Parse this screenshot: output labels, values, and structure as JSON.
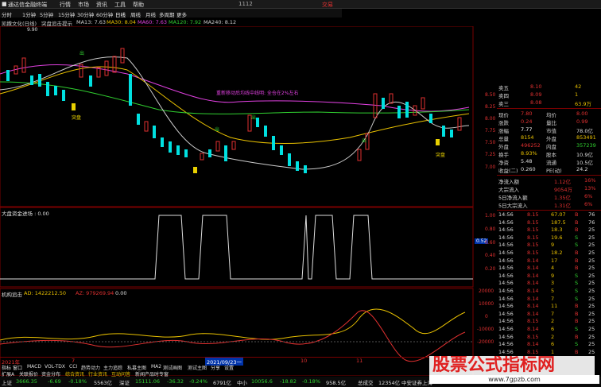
{
  "titlebar": {
    "app": "通达信金融终端",
    "menu": [
      "行情",
      "市场",
      "资讯",
      "工具",
      "帮助"
    ],
    "code": "1112",
    "trade": "交易"
  },
  "toolbar": [
    "分时",
    "1分钟",
    "5分钟",
    "15分钟",
    "30分钟",
    "60分钟",
    "日线",
    "周线",
    "月线",
    "多周期",
    "更多"
  ],
  "ma_legend": [
    {
      "text": "凯撒文化(日线)",
      "color": "#dddddd"
    },
    {
      "text": "突盘追击提示",
      "color": "#dddddd"
    },
    {
      "text": "MA13: 7.63",
      "color": "#dddddd"
    },
    {
      "text": "MA30: 8.04",
      "color": "#e8c000"
    },
    {
      "text": "MA60: 7.63",
      "color": "#e040e0"
    },
    {
      "text": "MA120: 7.92",
      "color": "#30d030"
    },
    {
      "text": "MA240: 8.12",
      "color": "#dddddd"
    }
  ],
  "chart": {
    "high_label": "9.90",
    "annotation": "重新移动后均线中线明: 全仓在2%左右",
    "signals": [
      "突盘",
      "突盘"
    ],
    "markers": [
      "出",
      "出",
      "出",
      "出"
    ]
  },
  "sub1": {
    "title": "大盘资金进场 : 0.00",
    "value_tag": "0.52"
  },
  "sub2": {
    "title": "机构追击",
    "ad": "AD: 1422212.50",
    "az": "AZ: 979269.94",
    "zero": "0.00"
  },
  "axis_main": [
    "8.50",
    "8.25",
    "8.00",
    "7.75",
    "7.50",
    "7.25",
    "7.00"
  ],
  "axis_sub1": [
    "1.00",
    "0.80",
    "0.60",
    "0.40",
    "0.20"
  ],
  "axis_sub2": [
    "20000",
    "10000",
    "0",
    "-10000",
    "-20000"
  ],
  "quote": {
    "book": [
      {
        "label": "卖五",
        "price": "8.10"
      },
      {
        "label": "卖四",
        "price": "8.09"
      },
      {
        "label": "卖三",
        "price": "8.08"
      }
    ],
    "vols": [
      "42",
      "1",
      "63.9万"
    ],
    "stats": [
      {
        "l1": "现价",
        "v1": "7.80",
        "l2": "均价",
        "v2": "8.00"
      },
      {
        "l1": "涨跌",
        "v1": "0.24",
        "l2": "量比",
        "v2": "0.99"
      },
      {
        "l1": "涨幅",
        "v1": "7.77",
        "l2": "市值",
        "v2": "78.0亿"
      },
      {
        "l1": "总量",
        "v1": "8154",
        "l2": "外盘",
        "v2": "853491"
      },
      {
        "l1": "外盘",
        "v1": "496252",
        "l2": "内盘",
        "v2": "357239"
      },
      {
        "l1": "换手",
        "v1": "8.93%",
        "l2": "股本",
        "v2": "10.9亿"
      },
      {
        "l1": "净资",
        "v1": "5.48",
        "l2": "流通",
        "v2": "10.5亿"
      },
      {
        "l1": "收益(二)",
        "v1": "0.260",
        "l2": "PE(动)",
        "v2": "24.2"
      }
    ],
    "flows": [
      {
        "label": "净流入额",
        "value": "1.12亿",
        "pct": "16%"
      },
      {
        "label": "大宗流入",
        "value": "9054万",
        "pct": "13%"
      },
      {
        "label": "5日净流入额",
        "value": "1.35亿",
        "pct": "6%"
      },
      {
        "label": "5日大宗流入",
        "value": "1.31亿",
        "pct": "6%"
      }
    ],
    "ticks": [
      {
        "t": "14:56",
        "p": "8.15",
        "v": "67.07",
        "s": "B",
        "n": "76"
      },
      {
        "t": "14:56",
        "p": "8.15",
        "v": "187.5",
        "s": "B",
        "n": "76"
      },
      {
        "t": "14:56",
        "p": "8.15",
        "v": "18.3",
        "s": "B",
        "n": "25"
      },
      {
        "t": "14:56",
        "p": "8.15",
        "v": "19.6",
        "s": "S",
        "n": "25"
      },
      {
        "t": "14:56",
        "p": "8.15",
        "v": "9",
        "s": "S",
        "n": "25"
      },
      {
        "t": "14:56",
        "p": "8.15",
        "v": "18.2",
        "s": "B",
        "n": "25"
      },
      {
        "t": "14:56",
        "p": "8.14",
        "v": "17",
        "s": "B",
        "n": "25"
      },
      {
        "t": "14:56",
        "p": "8.14",
        "v": "4",
        "s": "B",
        "n": "25"
      },
      {
        "t": "14:56",
        "p": "8.14",
        "v": "9",
        "s": "S",
        "n": "25"
      },
      {
        "t": "14:56",
        "p": "8.14",
        "v": "3",
        "s": "S",
        "n": "25"
      },
      {
        "t": "14:56",
        "p": "8.14",
        "v": "5",
        "s": "S",
        "n": "25"
      },
      {
        "t": "14:56",
        "p": "8.14",
        "v": "7",
        "s": "S",
        "n": "25"
      },
      {
        "t": "14:56",
        "p": "8.14",
        "v": "11",
        "s": "B",
        "n": "25"
      },
      {
        "t": "14:56",
        "p": "8.14",
        "v": "7",
        "s": "B",
        "n": "25"
      },
      {
        "t": "14:56",
        "p": "8.15",
        "v": "2",
        "s": "B",
        "n": "25"
      },
      {
        "t": "14:56",
        "p": "8.14",
        "v": "6",
        "s": "S",
        "n": "25"
      },
      {
        "t": "14:56",
        "p": "8.15",
        "v": "2",
        "s": "B",
        "n": "25"
      },
      {
        "t": "14:56",
        "p": "8.14",
        "v": "6",
        "s": "S",
        "n": "25"
      },
      {
        "t": "14:56",
        "p": "8.15",
        "v": "1",
        "s": "B",
        "n": "25"
      }
    ]
  },
  "dates": {
    "left": "2021年",
    "mid": "2021/09/23一",
    "marks": [
      "7",
      "10",
      "11"
    ]
  },
  "func_tabs": [
    "指标",
    "窗口",
    "MACD",
    "VOL-TDX",
    "CCI",
    "趋势动力",
    "主力追踪",
    "私募主图",
    "MA2",
    "测试画图",
    "测试主图",
    "分享",
    "设置"
  ],
  "sub_tabs": [
    "扩展A",
    "关联报价",
    "资金分布",
    "综合资讯",
    "行业资讯",
    "互动问答",
    "新闻产品时专窗"
  ],
  "indices": [
    {
      "name": "上证",
      "value": "3666.35",
      "chg": "-6.69",
      "pct": "-0.18%",
      "amt": "5563亿"
    },
    {
      "name": "深证",
      "value": "15111.06",
      "chg": "-36.32",
      "pct": "-0.24%",
      "amt": "6791亿"
    },
    {
      "name": "中小",
      "value": "10056.6",
      "chg": "-18.82",
      "pct": "-0.18%",
      "amt": "958.5亿"
    },
    {
      "name": "总成交",
      "value": "12354亿",
      "chg": "",
      "pct": "",
      "amt": "中安证券上海"
    }
  ],
  "watermark": {
    "title": "股票公式指标网",
    "url": "www.7gpzb.com"
  }
}
